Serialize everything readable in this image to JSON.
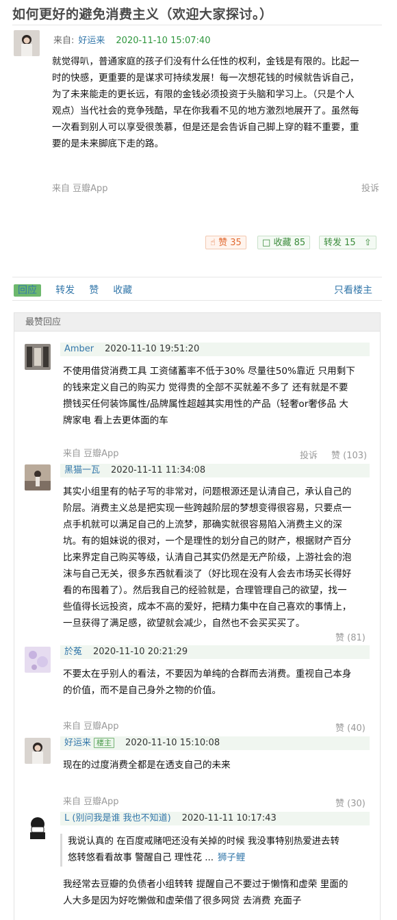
{
  "post": {
    "title": "如何更好的避免消费主义（欢迎大家探讨。）",
    "from_label": "来自:",
    "author": "好运来",
    "time": "2020-11-10 15:07:40",
    "content_lines": [
      "就觉得叭，普通家庭的孩子们没有什么任性的权利，金钱是有限的。比起一",
      "时的快感，更重要的是谋求可持续发展！每一次想花钱的时候就告诉自己，",
      "为了未来能走的更长远，有限的金钱必须投资于头脑和学习上。（只是个人",
      "观点）当代社会的竞争残酷，早在你我看不见的地方激烈地展开了。虽然每",
      "一次看到别人可以享受很羡慕，但是还是会告诉自己脚上穿的鞋不重要，重",
      "要的是未来脚底下走的路。"
    ],
    "source": "来自 豆瓣App",
    "report": "投诉",
    "like_label": "赞 35",
    "fav_label": "收藏 85",
    "share_label": "转发 15"
  },
  "actions": {
    "reply": "回应",
    "forward": "转发",
    "like": "赞",
    "collect": "收藏",
    "only_op": "只看楼主"
  },
  "section_title": "最赞回应",
  "comments": [
    {
      "name": "Amber",
      "time": "2020-11-10 19:51:20",
      "lines": [
        "不使用借贷消费工具 工资储蓄率不低于30% 尽量往50%靠近 只用剩下",
        "的钱来定义自己的购买力 觉得贵的全部不买就差不多了 还有就是不要",
        "攒钱买任何装饰属性/品牌属性超越其实用性的产品（轻奢or奢侈品 大",
        "牌家电 看上去更体面的车"
      ],
      "source": "来自 豆瓣App",
      "report": "投诉",
      "likes": "赞 (103)"
    },
    {
      "name": "黑猫一瓦",
      "time": "2020-11-11 11:34:08",
      "lines": [
        "其实小组里有的帖子写的非常对，问题根源还是认清自己，承认自己的",
        "阶层。消费主义总是把实现一些跨越阶层的梦想变得很容易，只要点一",
        "点手机就可以满足自己的上流梦，那确实就很容易陷入消费主义的深",
        "坑。有的姐妹说的很对，一个是理性的划分自己的财产，根据财产百分",
        "比来界定自己购买等级，认清自己其实仍然是无产阶级，上游社会的泡",
        "沫与自己无关，很多东西就看淡了（好比现在没有人会去市场买长得好",
        "看的布囤着了）。然后我自己的经验就是，合理管理自己的欲望，找一",
        "些值得长远投资，成本不高的爱好，把精力集中在自己喜欢的事情上，",
        "一旦获得了满足感，欲望就会减少，自然也不会买买买了。"
      ],
      "likes": "赞 (81)"
    },
    {
      "name": "於菟",
      "time": "2020-11-10 20:21:29",
      "lines": [
        "不要太在乎别人的看法，不要因为单纯的合群而去消费。重视自己本身",
        "的价值，而不是自己身外之物的价值。"
      ],
      "source": "来自 豆瓣App",
      "likes": "赞 (40)"
    },
    {
      "name": "好运来",
      "badge": "楼主",
      "time": "2020-11-10 15:10:08",
      "lines": [
        "现在的过度消费全都是在透支自己的未来"
      ],
      "source": "来自 豆瓣App",
      "likes": "赞 (30)"
    },
    {
      "name": "L (别问我是谁 我也不知道)",
      "time": "2020-11-11 10:17:43",
      "quote_lines": [
        "我说认真的 在百度戒赌吧还没有关掉的时候 我没事特别热爱进去转",
        "悠转悠看看故事 警醒自己 理性花 ..."
      ],
      "quote_author": "狮子鲤",
      "lines": [
        "我经常去豆瓣的负债者小组转转 提醒自己不要过于懒惰和虚荣 里面的",
        "人大多是因为好吃懒做和虚荣借了很多网贷 去消费 充面子"
      ]
    }
  ]
}
